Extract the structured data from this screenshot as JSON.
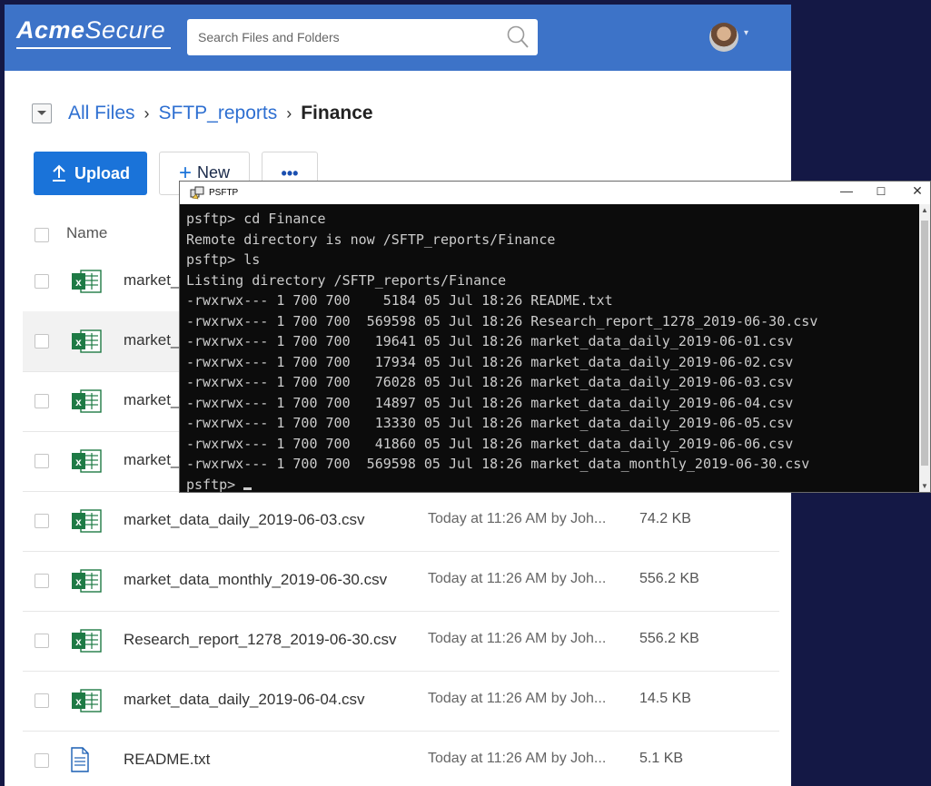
{
  "app": {
    "logo_bold": "Acme",
    "logo_rest": "Secure",
    "search_placeholder": "Search Files and Folders"
  },
  "breadcrumb": {
    "items": [
      "All Files",
      "SFTP_reports"
    ],
    "current": "Finance"
  },
  "toolbar": {
    "upload_label": "Upload",
    "new_label": "New",
    "more_label": "•••"
  },
  "table": {
    "name_header": "Name",
    "rows": [
      {
        "name": "market_",
        "modified": "",
        "size": ""
      },
      {
        "name": "market_",
        "modified": "",
        "size": ""
      },
      {
        "name": "market_",
        "modified": "",
        "size": ""
      },
      {
        "name": "market_",
        "modified": "",
        "size": ""
      },
      {
        "name": "market_data_daily_2019-06-03.csv",
        "modified": "Today at 11:26 AM by Joh...",
        "size": "74.2 KB"
      },
      {
        "name": "market_data_monthly_2019-06-30.csv",
        "modified": "Today at 11:26 AM by Joh...",
        "size": "556.2 KB"
      },
      {
        "name": "Research_report_1278_2019-06-30.csv",
        "modified": "Today at 11:26 AM by Joh...",
        "size": "556.2 KB"
      },
      {
        "name": "market_data_daily_2019-06-04.csv",
        "modified": "Today at 11:26 AM by Joh...",
        "size": "14.5 KB"
      },
      {
        "name": "README.txt",
        "modified": "Today at 11:26 AM by Joh...",
        "size": "5.1 KB"
      }
    ]
  },
  "terminal": {
    "title": "PSFTP",
    "lines": [
      "psftp> cd Finance",
      "Remote directory is now /SFTP_reports/Finance",
      "psftp> ls",
      "Listing directory /SFTP_reports/Finance",
      "-rwxrwx--- 1 700 700    5184 05 Jul 18:26 README.txt",
      "-rwxrwx--- 1 700 700  569598 05 Jul 18:26 Research_report_1278_2019-06-30.csv",
      "-rwxrwx--- 1 700 700   19641 05 Jul 18:26 market_data_daily_2019-06-01.csv",
      "-rwxrwx--- 1 700 700   17934 05 Jul 18:26 market_data_daily_2019-06-02.csv",
      "-rwxrwx--- 1 700 700   76028 05 Jul 18:26 market_data_daily_2019-06-03.csv",
      "-rwxrwx--- 1 700 700   14897 05 Jul 18:26 market_data_daily_2019-06-04.csv",
      "-rwxrwx--- 1 700 700   13330 05 Jul 18:26 market_data_daily_2019-06-05.csv",
      "-rwxrwx--- 1 700 700   41860 05 Jul 18:26 market_data_daily_2019-06-06.csv",
      "-rwxrwx--- 1 700 700  569598 05 Jul 18:26 market_data_monthly_2019-06-30.csv"
    ],
    "prompt": "psftp> ",
    "controls": {
      "minimize": "—",
      "maximize": "☐",
      "close": "✕"
    }
  },
  "colors": {
    "page_background": "#141845",
    "header_blue": "#3d73c8",
    "primary_button": "#1a73d9",
    "link_blue": "#2e6fd1",
    "excel_green": "#1e7a45"
  }
}
